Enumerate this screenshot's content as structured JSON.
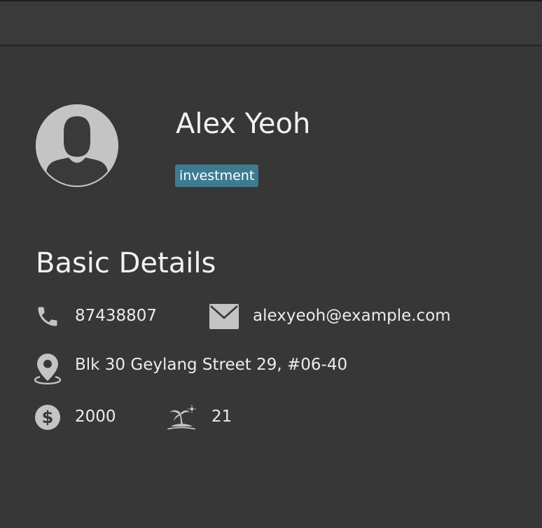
{
  "person": {
    "name": "Alex Yeoh",
    "tags": [
      "investment"
    ]
  },
  "section": {
    "title": "Basic Details"
  },
  "details": {
    "phone": "87438807",
    "email": "alexyeoh@example.com",
    "address": "Blk 30 Geylang Street 29, #06-40",
    "income": "2000",
    "leave": "21"
  },
  "icons": {
    "avatar": "user-avatar-icon",
    "phone": "phone-icon",
    "email": "envelope-icon",
    "address": "location-pin-icon",
    "income": "dollar-icon",
    "leave": "beach-island-icon"
  },
  "colors": {
    "background": "#373737",
    "tag_background": "#3e7b91",
    "icon": "#c4c4c4",
    "text": "#ececec"
  }
}
